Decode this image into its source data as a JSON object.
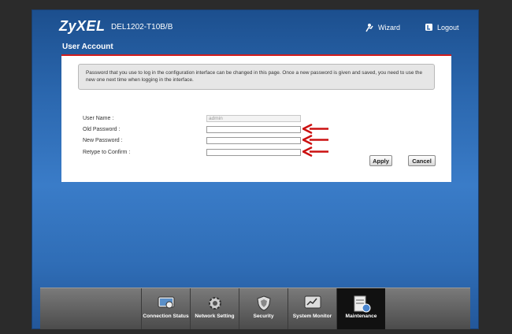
{
  "header": {
    "brand": "ZyXEL",
    "model": "DEL1202-T10B/B",
    "wizard_label": "Wizard",
    "logout_label": "Logout"
  },
  "page": {
    "title": "User Account",
    "notice": "Password that you use to log in the configuration interface can be changed in this page. Once a new password is given and saved, you need to use the new one next time when logging in the interface."
  },
  "form": {
    "username_label": "User Name :",
    "username_value": "admin",
    "old_password_label": "Old Password :",
    "new_password_label": "New Password :",
    "retype_label": "Retype to Confirm :",
    "apply_label": "Apply",
    "cancel_label": "Cancel"
  },
  "nav": {
    "items": [
      {
        "label": "Connection Status"
      },
      {
        "label": "Network Setting"
      },
      {
        "label": "Security"
      },
      {
        "label": "System Monitor"
      },
      {
        "label": "Maintenance"
      }
    ],
    "active": "Maintenance"
  },
  "colors": {
    "accent_red": "#d21d1d",
    "background_blue": "#2a66ad",
    "arrow_red": "#cc1111"
  }
}
